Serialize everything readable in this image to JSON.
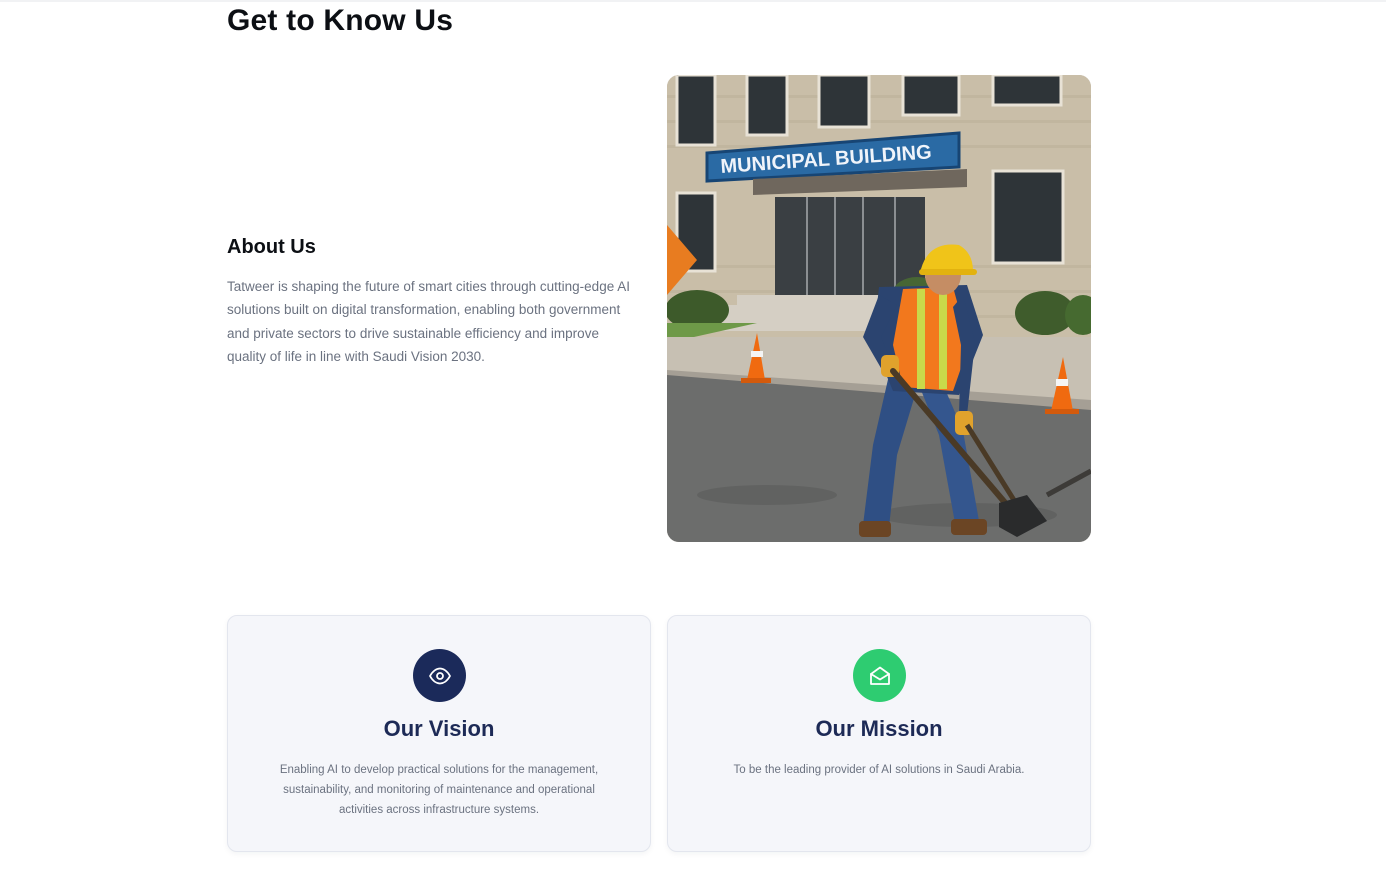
{
  "section": {
    "title": "Get to Know Us"
  },
  "about": {
    "heading": "About Us",
    "body": "Tatweer is shaping the future of smart cities through cutting-edge AI solutions built on digital transformation, enabling both government and private sectors to drive sustainable efficiency and improve quality of life in line with Saudi Vision 2030."
  },
  "photo": {
    "sign_text": "MUNICIPAL BUILDING"
  },
  "cards": [
    {
      "title": "Our Vision",
      "text": "Enabling AI to develop practical solutions for the management, sustainability, and monitoring of maintenance and operational activities across infrastructure systems.",
      "icon": "eye-icon",
      "color": "#1b2a5a"
    },
    {
      "title": "Our Mission",
      "text": "To be the leading provider of AI solutions in Saudi Arabia.",
      "icon": "envelope-open-icon",
      "color": "#2ecc71"
    }
  ]
}
